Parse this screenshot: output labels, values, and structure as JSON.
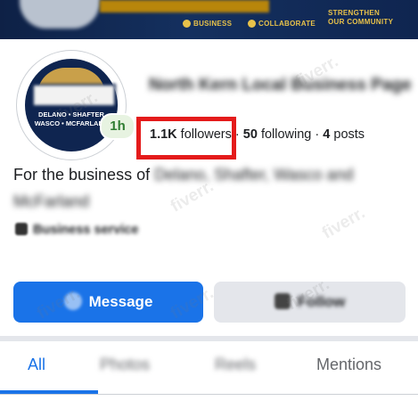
{
  "cover": {
    "items": [
      "BUSINESS",
      "COLLABORATE",
      "STRENGTHEN",
      "OUR COMMUNITY"
    ]
  },
  "avatar": {
    "line1": "DELANO • SHAFTER",
    "line2": "WASCO • MCFARLAND"
  },
  "presence": {
    "active_time": "1h"
  },
  "profile": {
    "name": "North Kern Local Business Page",
    "followers_count": "1.1K",
    "followers_label": "followers",
    "following_count": "50",
    "following_label": "following",
    "posts_count": "4",
    "posts_label": "posts",
    "separator": " · ",
    "bio_visible": "For the business of",
    "bio_blurred": "Delano, Shafter, Wasco and McFarland",
    "category": "Business service"
  },
  "actions": {
    "message_label": "Message",
    "follow_label": "Follow"
  },
  "tabs": [
    {
      "label": "All",
      "active": true
    },
    {
      "label": "Photos",
      "active": false
    },
    {
      "label": "Reels",
      "active": false
    },
    {
      "label": "Mentions",
      "active": false
    }
  ],
  "watermark": "fiverr.",
  "colors": {
    "primary_blue": "#1a73e8",
    "highlight_red": "#e41b1b",
    "cover_navy": "#0f2550",
    "online_green": "#2f7d32"
  }
}
